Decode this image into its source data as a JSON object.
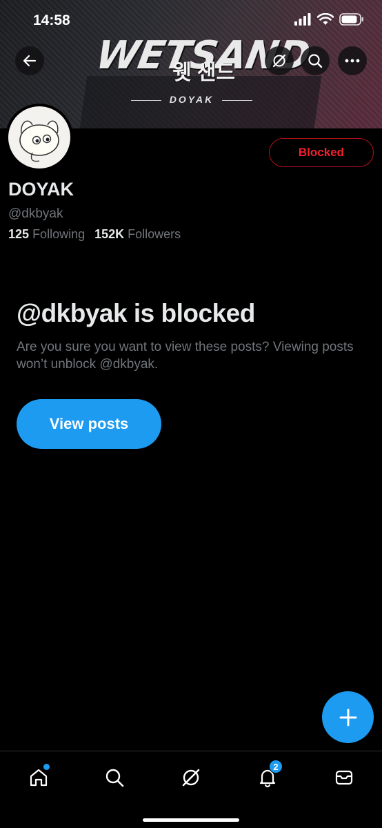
{
  "status_bar": {
    "time": "14:58"
  },
  "banner": {
    "title": "WETSAND",
    "korean": "웻 샌드",
    "subtitle": "DOYAK"
  },
  "profile": {
    "name": "DOYAK",
    "handle": "@dkbyak",
    "following_count": "125",
    "following_label": "Following",
    "followers_count": "152K",
    "followers_label": "Followers",
    "relationship_button": "Blocked"
  },
  "blocked_notice": {
    "title": "@dkbyak is blocked",
    "description": "Are you sure you want to view these posts? Viewing posts won’t unblock @dkbyak.",
    "button": "View posts"
  },
  "tabbar": {
    "notifications_badge": "2"
  },
  "colors": {
    "accent": "#1d9bf0",
    "danger": "#f4212e",
    "muted": "#71767b"
  }
}
